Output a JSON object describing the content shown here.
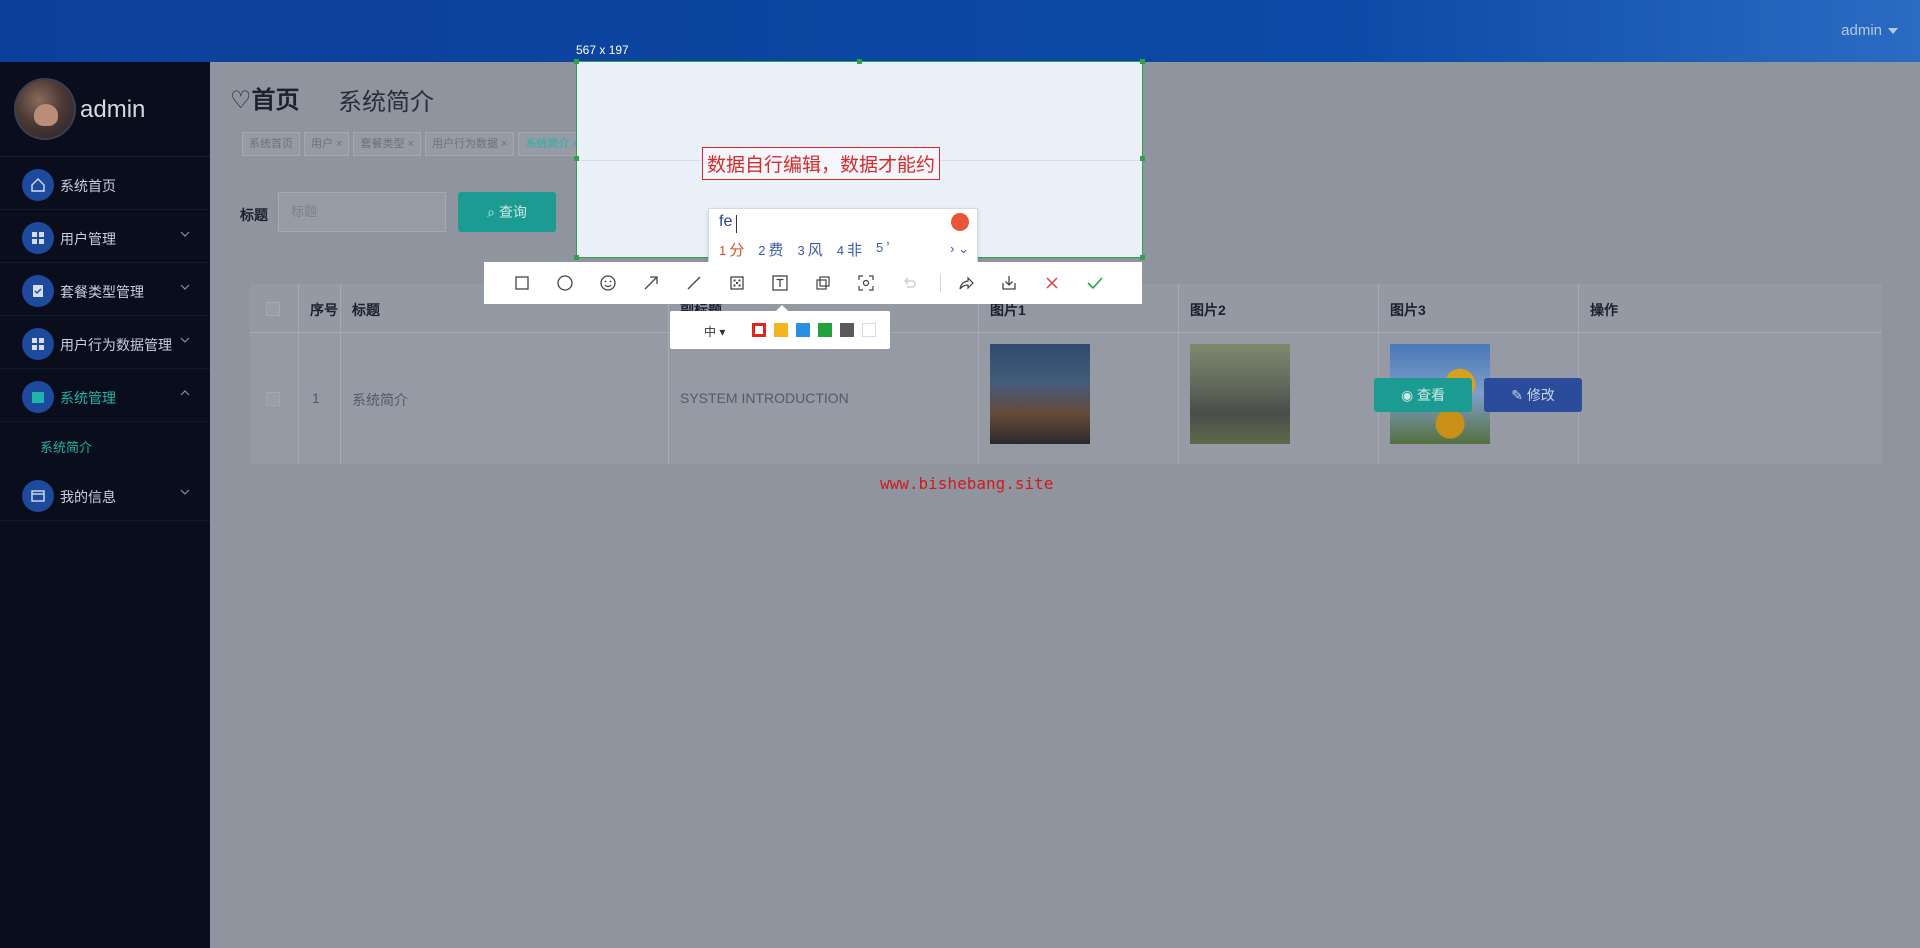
{
  "topbar": {
    "user": "admin"
  },
  "sidebar": {
    "name": "admin",
    "items": [
      {
        "label": "系统首页",
        "icon": "home-icon"
      },
      {
        "label": "用户管理",
        "icon": "grid-icon"
      },
      {
        "label": "套餐类型管理",
        "icon": "clipboard-icon"
      },
      {
        "label": "用户行为数据管理",
        "icon": "grid-icon"
      },
      {
        "label": "系统管理",
        "icon": "archive-icon"
      },
      {
        "label": "我的信息",
        "icon": "card-icon"
      }
    ],
    "sub_item": "系统简介"
  },
  "main": {
    "title": "♡首页",
    "subtitle": "系统简介",
    "tabs": [
      "系统首页",
      "用户 ×",
      "套餐类型 ×",
      "用户行为数据 ×",
      "系统简介 ×"
    ]
  },
  "search": {
    "label": "标题",
    "placeholder": "标题",
    "button": "查询"
  },
  "table": {
    "headers": [
      "序号",
      "标题",
      "副标题",
      "图片1",
      "图片2",
      "图片3",
      "操作"
    ],
    "row": {
      "index": "1",
      "title": "系统简介",
      "subtitle": "SYSTEM INTRODUCTION"
    },
    "view_label": "查看",
    "edit_label": "修改"
  },
  "watermark": "www.bishebang.site",
  "overlay": {
    "size": "567 x 197",
    "text_annotation": "数据自行编辑，数据才能约",
    "ime_input": "fe",
    "ime_candidates": [
      {
        "num": "1",
        "text": "分"
      },
      {
        "num": "2",
        "text": "费"
      },
      {
        "num": "3",
        "text": "风"
      },
      {
        "num": "4",
        "text": "非"
      },
      {
        "num": "5",
        "text": "’"
      }
    ],
    "size_option": "中",
    "colors": [
      "#e0261c",
      "#f2b51d",
      "#2b8fe0",
      "#21a13b",
      "#5a5a5a",
      "#ffffff"
    ]
  }
}
